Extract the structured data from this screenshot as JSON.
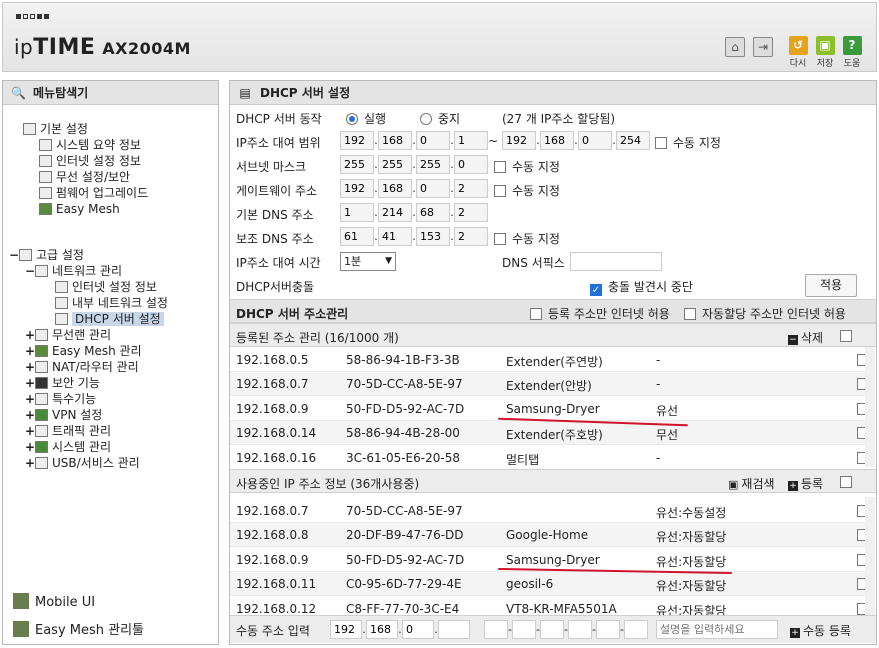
{
  "header": {
    "brand_prefix": "ip",
    "brand_bold": "TIME",
    "model": "AX2004M",
    "buttons": [
      {
        "label": "다시",
        "color": "#e6a21a",
        "glyph": "↺"
      },
      {
        "label": "저장",
        "color": "#8cbf2a",
        "glyph": "▣"
      },
      {
        "label": "도움",
        "color": "#3a9b3a",
        "glyph": "?"
      }
    ]
  },
  "sidebar": {
    "title": "메뉴탐색기",
    "groups": [
      {
        "label": "기본 설정",
        "items": [
          "시스템 요약 정보",
          "인터넷 설정 정보",
          "무선 설정/보안",
          "펌웨어 업그레이드",
          "Easy Mesh"
        ]
      },
      {
        "label": "고급 설정",
        "sub": "네트워크 관리",
        "subitems": [
          "인터넷 설정 정보",
          "내부 네트워크 설정",
          "DHCP 서버 설정"
        ],
        "items": [
          "무선랜 관리",
          "Easy Mesh 관리",
          "NAT/라우터 관리",
          "보안 기능",
          "특수기능",
          "VPN 설정",
          "트래픽 관리",
          "시스템 관리",
          "USB/서비스 관리"
        ]
      }
    ],
    "mobile_ui": "Mobile UI",
    "mesh_tool": "Easy Mesh 관리툴"
  },
  "main": {
    "title": "DHCP 서버 설정",
    "dhcp_op_label": "DHCP 서버 동작",
    "run": "실행",
    "stop": "중지",
    "assigned": "(27 개 IP주소 할당됨)",
    "range_label": "IP주소 대여 범위",
    "range_start": [
      "192",
      "168",
      "0",
      "1"
    ],
    "range_end": [
      "192",
      "168",
      "0",
      "254"
    ],
    "manual": "수동 지정",
    "subnet_label": "서브넷 마스크",
    "subnet": [
      "255",
      "255",
      "255",
      "0"
    ],
    "gateway_label": "게이트웨이 주소",
    "gateway": [
      "192",
      "168",
      "0",
      "2"
    ],
    "dns1_label": "기본 DNS 주소",
    "dns1": [
      "1",
      "214",
      "68",
      "2"
    ],
    "dns2_label": "보조 DNS 주소",
    "dns2": [
      "61",
      "41",
      "153",
      "2"
    ],
    "lease_label": "IP주소 대여 시간",
    "lease_value": "1분",
    "dns_suffix_label": "DNS 서픽스",
    "conflict_label": "DHCP서버충돌",
    "conflict_stop": "충돌 발견시 중단",
    "apply": "적용",
    "addr_mgmt": "DHCP 서버 주소관리",
    "reg_only": "등록 주소만 인터넷 허용",
    "auto_only": "자동할당 주소만 인터넷 허용",
    "registered_title": "등록된 주소 관리 (16/1000 개)",
    "delete": "삭제",
    "registered": [
      {
        "ip": "192.168.0.5",
        "mac": "58-86-94-1B-F3-3B",
        "name": "Extender(주연방)",
        "type": "-"
      },
      {
        "ip": "192.168.0.7",
        "mac": "70-5D-CC-A8-5E-97",
        "name": "Extender(안방)",
        "type": "-"
      },
      {
        "ip": "192.168.0.9",
        "mac": "50-FD-D5-92-AC-7D",
        "name": "Samsung-Dryer",
        "type": "유선"
      },
      {
        "ip": "192.168.0.14",
        "mac": "58-86-94-4B-28-00",
        "name": "Extender(주호방)",
        "type": "무선"
      },
      {
        "ip": "192.168.0.16",
        "mac": "3C-61-05-E6-20-58",
        "name": "멀티탭",
        "type": "-"
      }
    ],
    "inuse_title": "사용중인 IP 주소 정보 (36개사용중)",
    "rescan": "재검색",
    "register": "등록",
    "inuse": [
      {
        "ip": "192.168.0.7",
        "mac": "70-5D-CC-A8-5E-97",
        "name": "",
        "type": "유선:수동설정"
      },
      {
        "ip": "192.168.0.8",
        "mac": "20-DF-B9-47-76-DD",
        "name": "Google-Home",
        "type": "유선:자동할당"
      },
      {
        "ip": "192.168.0.9",
        "mac": "50-FD-D5-92-AC-7D",
        "name": "Samsung-Dryer",
        "type": "유선:자동할당"
      },
      {
        "ip": "192.168.0.11",
        "mac": "C0-95-6D-77-29-4E",
        "name": "geosil-6",
        "type": "유선:자동할당"
      },
      {
        "ip": "192.168.0.12",
        "mac": "C8-FF-77-70-3C-E4",
        "name": "VT8-KR-MFA5501A",
        "type": "유선:자동할당"
      }
    ],
    "manual_input_label": "수동 주소 입력",
    "manual_ip": [
      "192",
      "168",
      "0",
      ""
    ],
    "desc_placeholder": "설명을 입력하세요",
    "manual_register": "수동 등록"
  }
}
